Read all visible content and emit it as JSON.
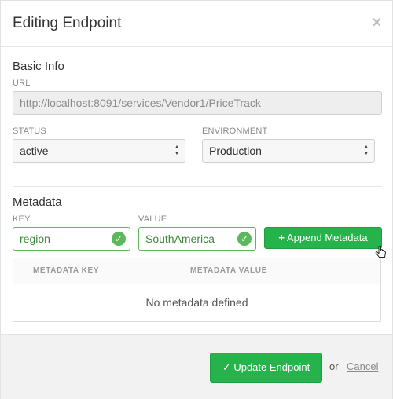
{
  "modal": {
    "title": "Editing Endpoint",
    "close_glyph": "×"
  },
  "basic_info": {
    "section_title": "Basic Info",
    "url_label": "URL",
    "url_value": "http://localhost:8091/services/Vendor1/PriceTrack",
    "status_label": "STATUS",
    "status_value": "active",
    "environment_label": "ENVIRONMENT",
    "environment_value": "Production"
  },
  "metadata": {
    "section_title": "Metadata",
    "key_label": "KEY",
    "key_value": "region",
    "value_label": "VALUE",
    "value_value": "SouthAmerica",
    "append_button_label": "Append Metadata",
    "append_button_icon": "+",
    "table": {
      "columns": [
        "METADATA KEY",
        "METADATA VALUE"
      ],
      "empty_text": "No metadata defined"
    }
  },
  "footer": {
    "update_button_label": "Update Endpoint",
    "update_button_icon": "✓",
    "or_text": "or",
    "cancel_label": "Cancel"
  },
  "colors": {
    "primary_green": "#27b34b",
    "valid_green": "#5cb85c"
  }
}
